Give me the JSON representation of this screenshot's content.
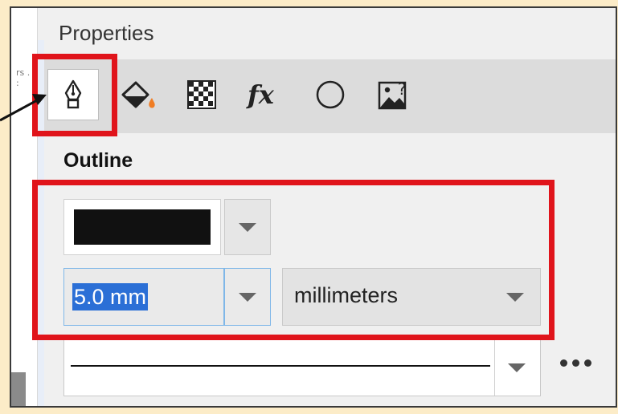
{
  "panel": {
    "title": "Properties",
    "tabs": [
      {
        "name": "outline-tab",
        "icon": "pen-nib-icon",
        "active": true
      },
      {
        "name": "fill-tab",
        "icon": "fill-bucket-icon"
      },
      {
        "name": "transparency-tab",
        "icon": "checkerboard-icon"
      },
      {
        "name": "effects-tab",
        "icon": "fx-icon",
        "label": "fx"
      },
      {
        "name": "corners-tab",
        "icon": "circle-icon"
      },
      {
        "name": "bitmap-tab",
        "icon": "image-question-icon"
      }
    ]
  },
  "outline": {
    "section_title": "Outline",
    "color": "#111111",
    "width_value": "5.0 mm",
    "units_value": "millimeters",
    "more_icon": "more-dots-icon"
  },
  "ruler_text": "rs\n. :",
  "colors": {
    "highlight": "#e0141b",
    "selection": "#2b6fd6",
    "background": "#fcecc8"
  }
}
